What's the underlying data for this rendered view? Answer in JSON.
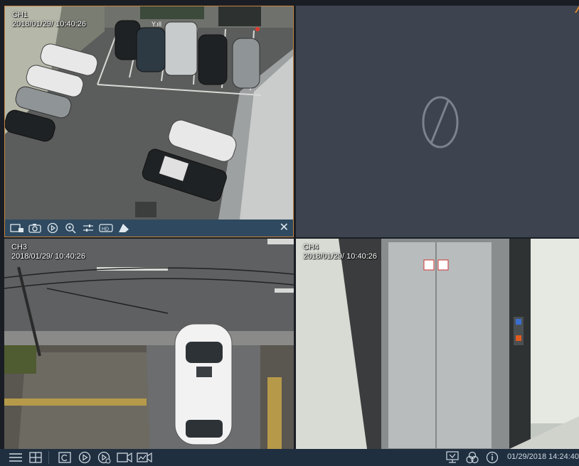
{
  "channels": [
    {
      "id": "ch1",
      "label": "CH1",
      "datetime": "2018/01/29/  10:40:26"
    },
    {
      "id": "ch2",
      "label": "",
      "datetime": ""
    },
    {
      "id": "ch3",
      "label": "CH3",
      "datetime": "2018/01/29/  10:40:26"
    },
    {
      "id": "ch4",
      "label": "CH4",
      "datetime": "2018/01/29/  10:40:26"
    }
  ],
  "ch1_toolbar": {
    "icons": [
      "record-icon",
      "snapshot-icon",
      "playback-icon",
      "zoom-in-icon",
      "image-adjust-icon",
      "hd-stream-icon",
      "ptz-icon",
      "close-icon"
    ]
  },
  "status_bar": {
    "clock": "01/29/2018 14:24:40",
    "icons": [
      "menu-icon",
      "layout-grid-icon",
      "sequence-icon",
      "playback-icon",
      "quick-playback-icon",
      "record-camera-icon",
      "motion-icon",
      "download-icon",
      "network-icon",
      "info-icon"
    ]
  },
  "colors": {
    "selected_border": "#c7843e",
    "toolbar_bg": "#2f4a60",
    "no_video_bg": "#3d4450"
  }
}
